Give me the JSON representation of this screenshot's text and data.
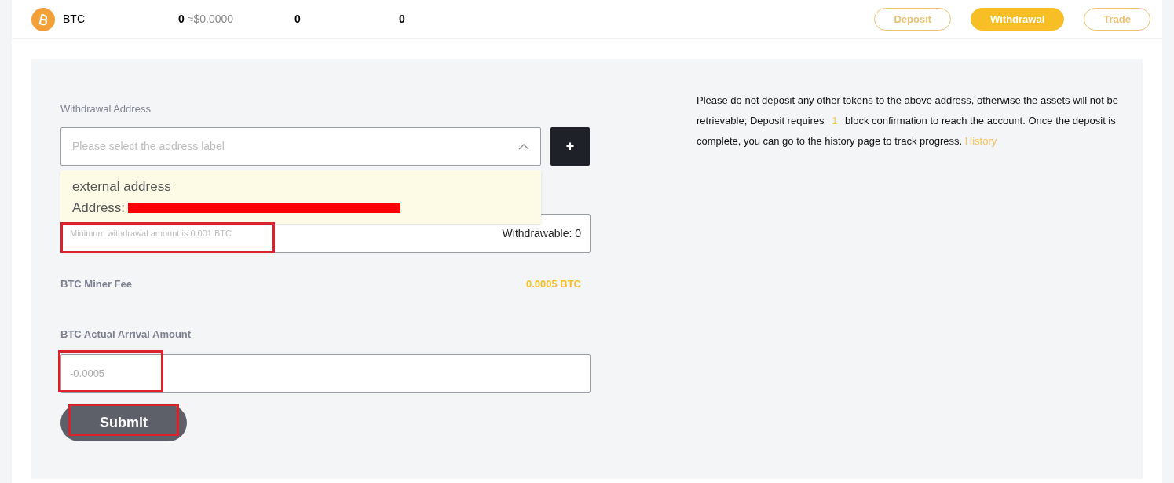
{
  "asset_row": {
    "symbol": "BTC",
    "total": "0",
    "total_usd": "≈$0.0000",
    "available": "0",
    "frozen": "0",
    "actions": [
      {
        "label": "Deposit",
        "selected": false
      },
      {
        "label": "Withdrawal",
        "selected": true
      },
      {
        "label": "Trade",
        "selected": false
      }
    ]
  },
  "form": {
    "address_label": "Withdrawal Address",
    "address_placeholder": "Please select the address label",
    "add_button": "+",
    "dropdown": {
      "expanded": true,
      "options": [
        {
          "name": "external address",
          "address_prefix": "Address:"
        }
      ]
    },
    "amount_placeholder": "Minimum withdrawal amount is 0.001 BTC",
    "withdrawable": "Withdrawable: 0",
    "fee_label": "BTC Miner Fee",
    "fee_value": "0.0005 BTC",
    "arrival_label": "BTC Actual Arrival Amount",
    "arrival_placeholder": "-0.0005",
    "submit": "Submit"
  },
  "notice": {
    "text": "Please do not deposit any other tokens to the above address, otherwise the assets will not be retrievable; Deposit requires",
    "confirmations": "1",
    "text_after": "block confirmation to reach the account. Once the deposit is complete, you can go to the history page to track progress.",
    "link": "History"
  }
}
